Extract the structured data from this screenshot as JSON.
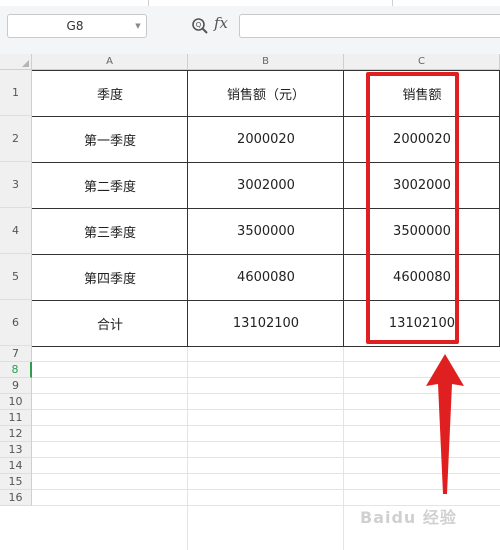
{
  "formula_bar": {
    "name_box": "G8",
    "zoom_icon": "zoom-formula-icon",
    "fx_label": "fx",
    "formula_value": ""
  },
  "columns": [
    "A",
    "B",
    "C"
  ],
  "rows": [
    "1",
    "2",
    "3",
    "4",
    "5",
    "6",
    "7",
    "8",
    "9",
    "10",
    "11",
    "12",
    "13",
    "14",
    "15",
    "16"
  ],
  "selected_row": "8",
  "table": {
    "header": [
      "季度",
      "销售额（元）",
      "销售额"
    ],
    "body": [
      [
        "第一季度",
        "2000020",
        "2000020"
      ],
      [
        "第二季度",
        "3002000",
        "3002000"
      ],
      [
        "第三季度",
        "3500000",
        "3500000"
      ],
      [
        "第四季度",
        "4600080",
        "4600080"
      ],
      [
        "合计",
        "13102100",
        "13102100"
      ]
    ]
  },
  "annotation": {
    "highlight_color": "#e02020"
  },
  "watermark": "Baidu 经验"
}
